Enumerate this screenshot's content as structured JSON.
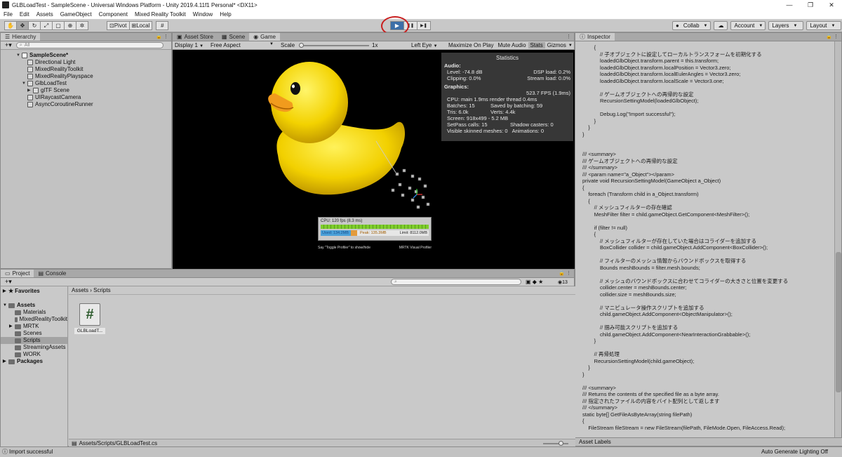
{
  "window": {
    "title": "GLBLoadTest - SampleScene - Universal Windows Platform - Unity 2019.4.11f1 Personal* <DX11>",
    "controls": [
      "—",
      "❐",
      "✕"
    ]
  },
  "menu": [
    "File",
    "Edit",
    "Assets",
    "GameObject",
    "Component",
    "Mixed Reality Toolkit",
    "Window",
    "Help"
  ],
  "toolbar": {
    "pivot_label": "Pivot",
    "local_label": "Local",
    "play_icon": "▶",
    "pause_icon": "❚❚",
    "step_icon": "▶❚",
    "collab_label": "Collab",
    "account_label": "Account",
    "layers_label": "Layers",
    "layout_label": "Layout"
  },
  "hierarchy": {
    "tab_label": "Hierarchy",
    "search_placeholder": "All",
    "scene_name": "SampleScene*",
    "items": [
      {
        "label": "Directional Light",
        "indent": 1
      },
      {
        "label": "MixedRealityToolkit",
        "indent": 1
      },
      {
        "label": "MixedRealityPlayspace",
        "indent": 1
      },
      {
        "label": "GlbLoadTest",
        "indent": 1
      },
      {
        "label": "glTF Scene",
        "indent": 2
      },
      {
        "label": "UIRaycastCamera",
        "indent": 1
      },
      {
        "label": "AsyncCoroutineRunner",
        "indent": 1
      }
    ]
  },
  "game": {
    "tabs": [
      "Asset Store",
      "Scene",
      "Game"
    ],
    "display": "Display 1",
    "aspect": "Free Aspect",
    "scale_label": "Scale",
    "scale_value": "1x",
    "left_eye": "Left Eye",
    "maximize": "Maximize On Play",
    "mute": "Mute Audio",
    "stats": "Stats",
    "gizmos": "Gizmos",
    "profiler": {
      "cpu": "CPU: 120 fps (8.3 ms)",
      "used": "Used: 134.2MB",
      "peak": "Peak: 135.3MB",
      "limit": "Limit: 8112.0MB",
      "say": "Say \"Toggle Profiler\" to show/hide",
      "brand": "MRTK Visual Profiler"
    }
  },
  "statistics": {
    "title": "Statistics",
    "audio_header": "Audio:",
    "level": "Level: -74.8 dB",
    "dsp": "DSP load: 0.2%",
    "clipping": "Clipping: 0.0%",
    "stream": "Stream load: 0.0%",
    "graphics_header": "Graphics:",
    "fps": "523.7 FPS (1.9ms)",
    "cpu": "CPU: main 1.9ms  render thread 0.4ms",
    "batches": "Batches: 15",
    "saved": "Saved by batching: 59",
    "tris": "Tris: 6.0k",
    "verts": "Verts: 4.4k",
    "screen": "Screen: 918x499 - 5.2 MB",
    "setpass": "SetPass calls: 15",
    "shadow": "Shadow casters: 0",
    "skinned": "Visible skinned meshes: 0",
    "animations": "Animations: 0"
  },
  "inspector": {
    "tab_label": "Inspector",
    "code": "        {\n            // 子オブジェクトに設定してローカルトランスフォームを初期化する\n            loadedGlbObject.transform.parent = this.transform;\n            loadedGlbObject.transform.localPosition = Vector3.zero;\n            loadedGlbObject.transform.localEulerAngles = Vector3.zero;\n            loadedGlbObject.transform.localScale = Vector3.one;\n\n            // ゲームオブジェクトへの再帰的な設定\n            RecursionSettingModel(loadedGlbObject);\n\n            Debug.Log(\"Import successful\");\n        }\n    }\n}\n\n\n/// <summary>\n/// ゲームオブジェクトへの再帰的な設定\n/// </summary>\n/// <param name=\"a_Object\"></param>\nprivate void RecursionSettingModel(GameObject a_Object)\n{\n    foreach (Transform child in a_Object.transform)\n    {\n        // メッシュフィルターの存在確認\n        MeshFilter filter = child.gameObject.GetComponent<MeshFilter>();\n\n        if (filter != null)\n        {\n            // メッシュフィルターが存在していた場合はコライダーを追加する\n            BoxCollider collider = child.gameObject.AddComponent<BoxCollider>();\n\n            // フィルターのメッシュ情報からバウンドボックスを取得する\n            Bounds meshBounds = filter.mesh.bounds;\n\n            // メッシュのバウンドボックスに合わせてコライダーの大きさと位置を変更する\n            collider.center = meshBounds.center;\n            collider.size = meshBounds.size;\n\n            // マニピュレータ操作スクリプトを追加する\n            child.gameObject.AddComponent<ObjectManipulator>();\n\n            // 掴み可能スクリプトを追加する\n            child.gameObject.AddComponent<NearInteractionGrabbable>();\n        }\n\n        // 再帰処理\n        RecursionSettingModel(child.gameObject);\n    }\n}\n\n/// <summary>\n/// Returns the contents of the specified file as a byte array.\n/// 指定されたファイルの内容をバイト配列として返します\n/// </summary>\nstatic byte[] GetFileAsByteArray(string filePath)\n{\n    FileStream fileStream = new FileStream(filePath, FileMode.Open, FileAccess.Read);\n\n    BinaryReader binaryReader = new BinaryReader(fileStream);",
    "asset_labels": "Asset Labels"
  },
  "project": {
    "tabs": [
      "Project",
      "Console"
    ],
    "badge": "13",
    "favorites": "Favorites",
    "assets_root": "Assets",
    "folders": [
      "Materials",
      "MixedRealityToolkit",
      "MRTK",
      "Scenes",
      "Scripts",
      "StreamingAssets",
      "WORK"
    ],
    "packages": "Packages",
    "breadcrumb": "Assets  ›  Scripts",
    "file_glyph": "#",
    "file_label": "GLBLoadT...",
    "path": "Assets/Scripts/GLBLoadTest.cs"
  },
  "status": {
    "left": "Import successful",
    "right": "Auto Generate Lighting Off"
  }
}
